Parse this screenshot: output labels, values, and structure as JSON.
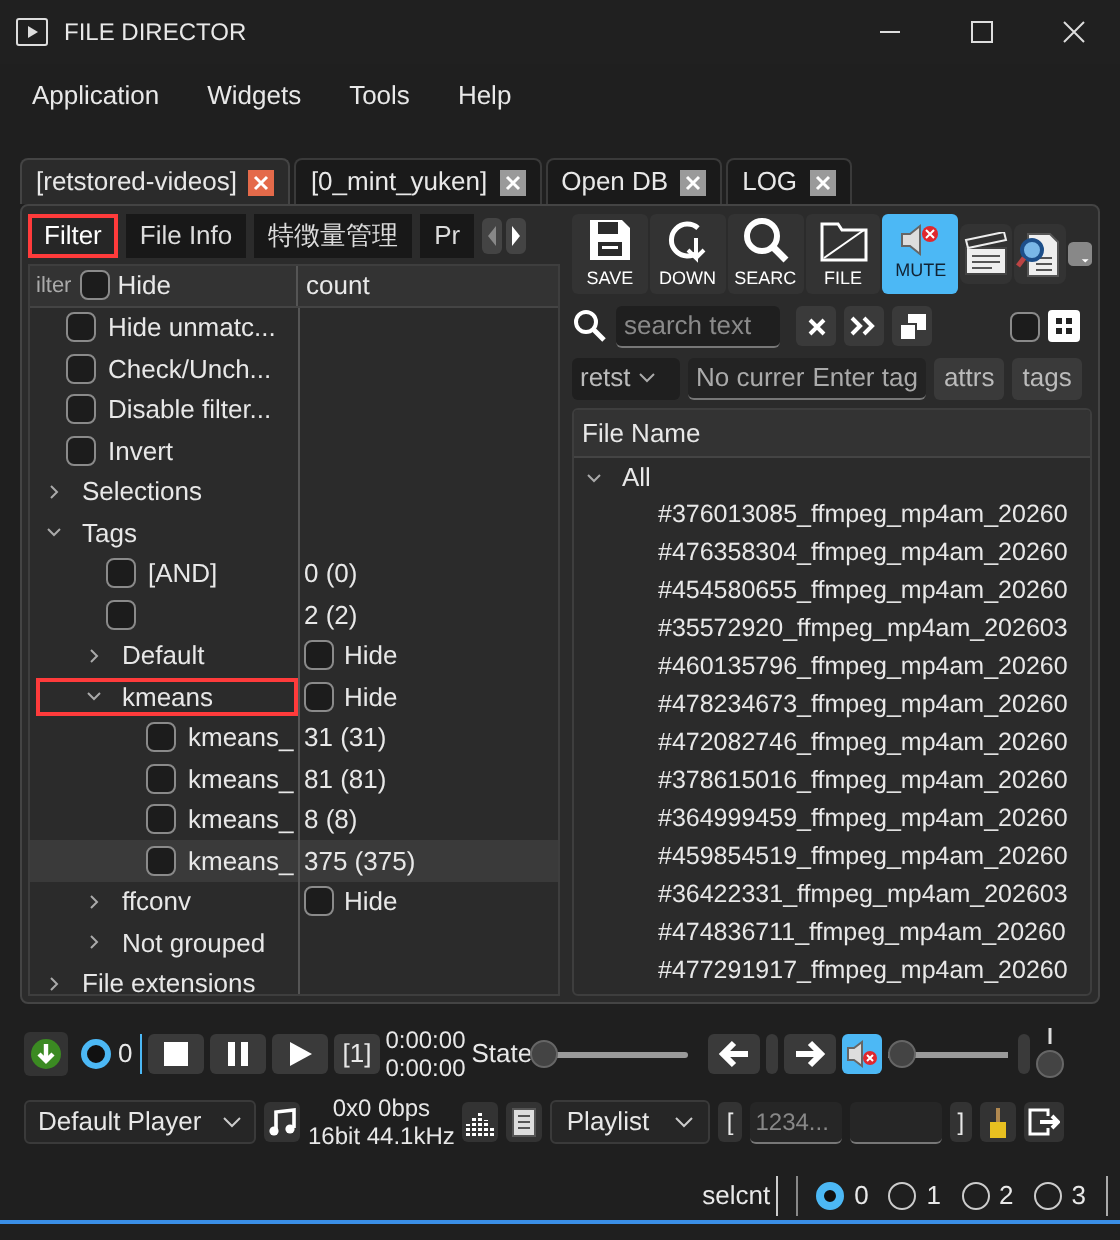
{
  "window": {
    "title": "FILE DIRECTOR"
  },
  "menu": [
    "Application",
    "Widgets",
    "Tools",
    "Help"
  ],
  "tabs": [
    {
      "label": "[retstored-videos]",
      "selected": true
    },
    {
      "label": "[0_mint_yuken]",
      "selected": false
    },
    {
      "label": "Open DB",
      "selected": false
    },
    {
      "label": "LOG",
      "selected": false
    }
  ],
  "sub_tabs": [
    {
      "label": "Filter",
      "selected": true,
      "annotated": true
    },
    {
      "label": "File Info",
      "selected": false,
      "annotated": false
    },
    {
      "label": "特徴量管理",
      "selected": false,
      "annotated": false
    },
    {
      "label": "Pr",
      "selected": false,
      "annotated": false
    }
  ],
  "filter_tree": {
    "column_1": "ilter",
    "hide": {
      "label": "Hide",
      "checked": false
    },
    "column_2": "count",
    "items": [
      {
        "kind": "check",
        "label": "Hide unmatc...",
        "checked": false
      },
      {
        "kind": "check",
        "label": "Check/Unch...",
        "checked": false
      },
      {
        "kind": "check",
        "label": "Disable filter...",
        "checked": false
      },
      {
        "kind": "check",
        "label": "Invert",
        "checked": false
      },
      {
        "kind": "group",
        "label": "Selections",
        "expanded": false
      },
      {
        "kind": "group",
        "label": "Tags",
        "expanded": true,
        "children": [
          {
            "kind": "check",
            "label": "[AND]",
            "checked": false,
            "count": "0 (0)"
          },
          {
            "kind": "check",
            "checked": false,
            "count": "2 (2)"
          },
          {
            "kind": "group",
            "label": "Default",
            "expanded": false,
            "hide": {
              "label": "Hide",
              "checked": false
            }
          },
          {
            "kind": "group",
            "label": "kmeans",
            "expanded": true,
            "annotated": true,
            "hide": {
              "label": "Hide",
              "checked": false
            },
            "children": [
              {
                "kind": "check",
                "label": "kmeans_",
                "checked": false,
                "count": "31 (31)",
                "selected": false
              },
              {
                "kind": "check",
                "label": "kmeans_",
                "checked": false,
                "count": "81 (81)",
                "selected": false
              },
              {
                "kind": "check",
                "label": "kmeans_",
                "checked": false,
                "count": "8 (8)",
                "selected": false
              },
              {
                "kind": "check",
                "label": "kmeans_",
                "checked": false,
                "count": "375 (375)",
                "selected": true
              }
            ]
          },
          {
            "kind": "group",
            "label": "ffconv",
            "expanded": false,
            "hide": {
              "label": "Hide",
              "checked": false
            }
          },
          {
            "kind": "group",
            "label": "Not grouped",
            "expanded": false
          }
        ]
      },
      {
        "kind": "group",
        "label": "File extensions",
        "expanded": false
      }
    ]
  },
  "toolbar": [
    {
      "kind": "save",
      "label": "SAVE",
      "active": false
    },
    {
      "kind": "down",
      "label": "DOWN",
      "active": false
    },
    {
      "kind": "search",
      "label": "SEARC",
      "active": false
    },
    {
      "kind": "file",
      "label": "FILE",
      "active": false
    },
    {
      "kind": "mute",
      "label": "MUTE",
      "active": true
    },
    {
      "kind": "clapper",
      "active": false
    },
    {
      "kind": "inspect",
      "active": false
    }
  ],
  "search": {
    "placeholder": "search text",
    "checked": false
  },
  "tag_row": {
    "dropdown": "retst",
    "current": "No currer",
    "tag_placeholder": "Enter tag",
    "buttons": [
      "attrs",
      "tags"
    ]
  },
  "file_list": {
    "column": "File Name",
    "group": {
      "label": "All",
      "expanded": true
    },
    "files": [
      "#376013085_ffmpeg_mp4am_20260",
      "#476358304_ffmpeg_mp4am_20260",
      "#454580655_ffmpeg_mp4am_20260",
      "#35572920_ffmpeg_mp4am_202603",
      "#460135796_ffmpeg_mp4am_20260",
      "#478234673_ffmpeg_mp4am_20260",
      "#472082746_ffmpeg_mp4am_20260",
      "#378615016_ffmpeg_mp4am_20260",
      "#364999459_ffmpeg_mp4am_20260",
      "#459854519_ffmpeg_mp4am_20260",
      "#36422331_ffmpeg_mp4am_202603",
      "#474836711_ffmpeg_mp4am_20260",
      "#477291917_ffmpeg_mp4am_20260"
    ]
  },
  "player": {
    "counter": "0",
    "index": "[1]",
    "time_current": "0:00:00",
    "time_total": "0:00:00",
    "state_label": "State",
    "seek": {
      "level": 0
    },
    "muted": true,
    "volume": {
      "level": 0
    },
    "player_select": "Default Player",
    "media_info": "0x0 0bps",
    "audio_info": "16bit 44.1kHz",
    "playlist_select": "Playlist",
    "bracket_open": "[",
    "range_placeholder": "1234...",
    "bracket_close": "]"
  },
  "status": {
    "label": "selcnt",
    "radios": [
      {
        "label": "0",
        "selected": true
      },
      {
        "label": "1",
        "selected": false
      },
      {
        "label": "2",
        "selected": false
      },
      {
        "label": "3",
        "selected": false
      }
    ]
  }
}
